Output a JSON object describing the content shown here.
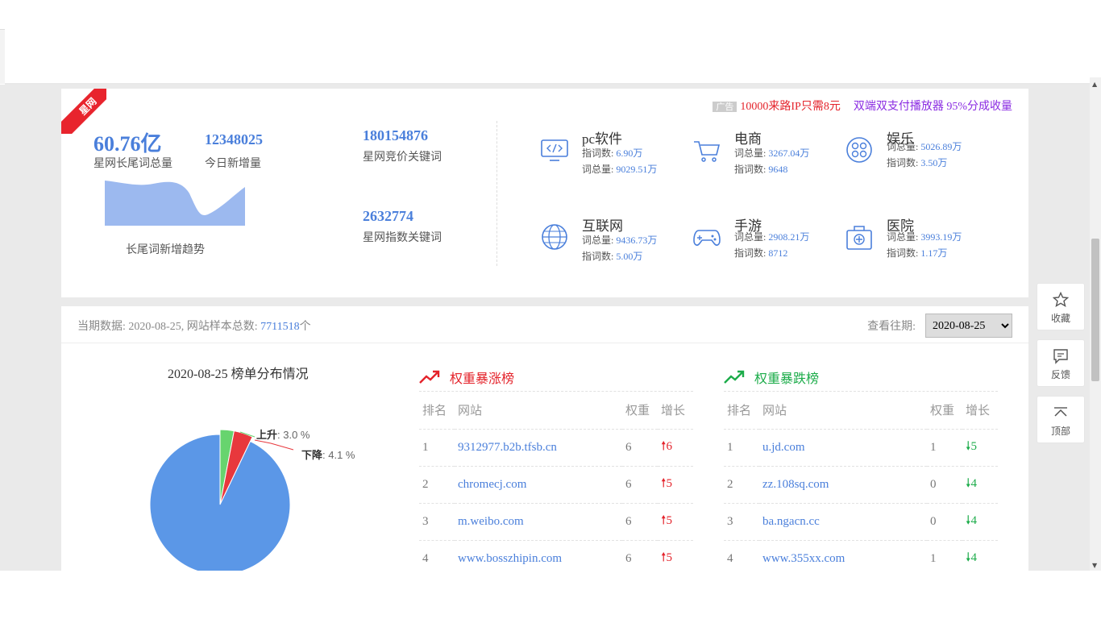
{
  "ribbon": "星网",
  "stats": {
    "total": "60.76亿",
    "total_label": "星网长尾词总量",
    "today": "12348025",
    "today_label": "今日新增量",
    "trend_label": "长尾词新增趋势",
    "bid": "180154876",
    "bid_label": "星网竞价关键词",
    "index": "2632774",
    "index_label": "星网指数关键词"
  },
  "ad": {
    "tag": "广告",
    "link1": "10000来路IP只需8元",
    "link2": "双端双支付播放器 95%分成收量"
  },
  "categories": [
    {
      "name": "pc软件",
      "icon": "monitor-code-icon",
      "r1l": "指词数:",
      "r1v": "6.90万",
      "r2l": "词总量:",
      "r2v": "9029.51万"
    },
    {
      "name": "电商",
      "icon": "cart-icon",
      "r1l": "词总量:",
      "r1v": "3267.04万",
      "r2l": "指词数:",
      "r2v": "9648"
    },
    {
      "name": "娱乐",
      "icon": "film-reel-icon",
      "r1l": "词总量:",
      "r1v": "5026.89万",
      "r2l": "指词数:",
      "r2v": "3.50万"
    },
    {
      "name": "互联网",
      "icon": "globe-icon",
      "r1l": "词总量:",
      "r1v": "9436.73万",
      "r2l": "指词数:",
      "r2v": "5.00万"
    },
    {
      "name": "手游",
      "icon": "gamepad-icon",
      "r1l": "词总量:",
      "r1v": "2908.21万",
      "r2l": "指词数:",
      "r2v": "8712"
    },
    {
      "name": "医院",
      "icon": "medkit-icon",
      "r1l": "词总量:",
      "r1v": "3993.19万",
      "r2l": "指词数:",
      "r2v": "1.17万"
    }
  ],
  "period": {
    "prefix": "当期数据: 2020-08-25,  网站样本总数:",
    "count": "7711518",
    "unit": "个",
    "view_label": "查看往期:",
    "selected": "2020-08-25"
  },
  "pie": {
    "title": "2020-08-25 榜单分布情况",
    "up_name": "上升",
    "up_val": ": 3.0 %",
    "down_name": "下降",
    "down_val": ": 4.1 %"
  },
  "chart_data": {
    "type": "pie",
    "title": "2020-08-25 榜单分布情况",
    "slices": [
      {
        "label": "上升",
        "value": 3.0,
        "color": "#67d46e"
      },
      {
        "label": "下降",
        "value": 4.1,
        "color": "#e8383d"
      },
      {
        "label": "",
        "value": 92.9,
        "color": "#5b97e7"
      }
    ]
  },
  "rise": {
    "title": "权重暴涨榜",
    "headers": [
      "排名",
      "网站",
      "权重",
      "增长"
    ],
    "rows": [
      {
        "rank": "1",
        "site": "9312977.b2b.tfsb.cn",
        "weight": "6",
        "inc": "6"
      },
      {
        "rank": "2",
        "site": "chromecj.com",
        "weight": "6",
        "inc": "5"
      },
      {
        "rank": "3",
        "site": "m.weibo.com",
        "weight": "6",
        "inc": "5"
      },
      {
        "rank": "4",
        "site": "www.bosszhipin.com",
        "weight": "6",
        "inc": "5"
      }
    ]
  },
  "fall": {
    "title": "权重暴跌榜",
    "headers": [
      "排名",
      "网站",
      "权重",
      "增长"
    ],
    "rows": [
      {
        "rank": "1",
        "site": "u.jd.com",
        "weight": "1",
        "inc": "5"
      },
      {
        "rank": "2",
        "site": "zz.108sq.com",
        "weight": "0",
        "inc": "4"
      },
      {
        "rank": "3",
        "site": "ba.ngacn.cc",
        "weight": "0",
        "inc": "4"
      },
      {
        "rank": "4",
        "site": "www.355xx.com",
        "weight": "1",
        "inc": "4"
      }
    ]
  },
  "side": {
    "fav": "收藏",
    "feedback": "反馈",
    "top": "顶部"
  },
  "colors": {
    "accent": "#4a7fdb",
    "up": "#e4232b",
    "down": "#1cac4a"
  }
}
